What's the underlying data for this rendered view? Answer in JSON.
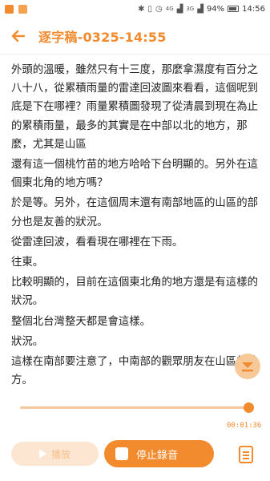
{
  "status_bar": {
    "left_icons": [
      {
        "icon": "notification-orange-icon",
        "color": "#f28a2e"
      },
      {
        "icon": "notification-app-icon",
        "color": "#f28a2e"
      }
    ],
    "right_icons": [
      "bluetooth-icon",
      "vibrate-icon",
      "alarm-icon",
      "4g-signal-icon",
      "3g-signal-icon"
    ],
    "signal_text_1": "4G",
    "signal_text_2": "3G",
    "battery_level": "94%",
    "time": "14:56"
  },
  "app_bar": {
    "back_icon": "back-arrow-icon",
    "title": "逐字稿-0325-14:55"
  },
  "transcript": {
    "paragraphs": [
      "外頭的溫暖，雖然只有十三度，那麼拿濕度有百分之八十八，從累積雨量的雷達回波圖來看看，這個呢到底是下在哪裡？雨量累積圖發現了從清晨到現在為止的累積雨量，最多的其實是在中部以北的地方，那麼，尤其是山區",
      "還有這一個桃竹苗的地方哈哈下台明顯的。另外在這個東北角的地方嗎？",
      "於是等。另外，在這個周末還有南部地區的山區的部分也是友善的狀況。",
      "從雷達回波，看看現在哪裡在下雨。",
      "往東。",
      "比較明顯的，目前在這個東北角的地方還是有這樣的狀況。",
      "整個北台灣整天都是會這樣。",
      "狀況。",
      "這樣在南部要注意了，中南部的觀眾朋友在山區的地方。"
    ]
  },
  "scroll_button": {
    "icon": "scroll-down-icon"
  },
  "player": {
    "progress_fraction": 1.0,
    "elapsed_time": "00:01:36",
    "play_label": "播放",
    "stop_label": "停止錄音",
    "doc_icon": "document-icon"
  },
  "colors": {
    "accent": "#f28a2e",
    "accent_light": "#fde6d1",
    "track": "#f3c79d"
  }
}
